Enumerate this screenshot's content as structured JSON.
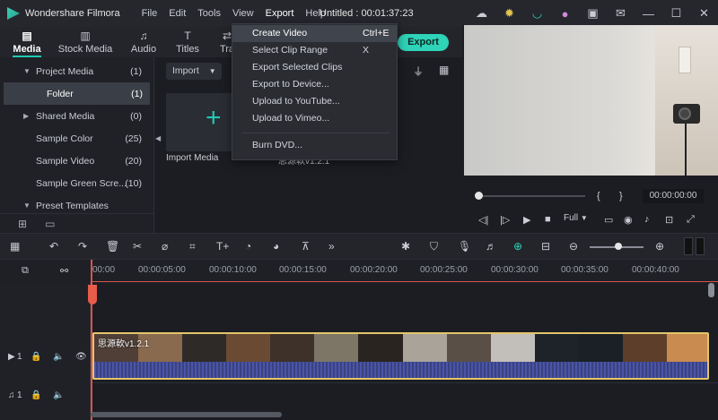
{
  "titlebar": {
    "app_name": "Wondershare Filmora",
    "menus": [
      "File",
      "Edit",
      "Tools",
      "View",
      "Export",
      "Help"
    ],
    "project_title": "Untitled : 00:01:37:23"
  },
  "tabs": [
    {
      "label": "Media",
      "icon": "media-icon"
    },
    {
      "label": "Stock Media",
      "icon": "stock-media-icon"
    },
    {
      "label": "Audio",
      "icon": "audio-icon"
    },
    {
      "label": "Titles",
      "icon": "titles-icon"
    },
    {
      "label": "Tra",
      "icon": "transitions-icon"
    }
  ],
  "export_button": "Export",
  "export_menu": [
    {
      "label": "Create Video",
      "shortcut": "Ctrl+E"
    },
    {
      "label": "Select Clip Range",
      "shortcut": "X"
    },
    {
      "label": "Export Selected Clips",
      "shortcut": ""
    },
    {
      "label": "Export to Device...",
      "shortcut": ""
    },
    {
      "label": "Upload to YouTube...",
      "shortcut": ""
    },
    {
      "label": "Upload to Vimeo...",
      "shortcut": ""
    },
    {
      "label": "Burn DVD...",
      "shortcut": ""
    }
  ],
  "sidebar": [
    {
      "label": "Project Media",
      "count": "(1)",
      "expanded": true
    },
    {
      "label": "Folder",
      "count": "(1)",
      "selected": true
    },
    {
      "label": "Shared Media",
      "count": "(0)",
      "expanded": false
    },
    {
      "label": "Sample Color",
      "count": "(25)"
    },
    {
      "label": "Sample Video",
      "count": "(20)"
    },
    {
      "label": "Sample Green Scre...",
      "count": "(10)"
    },
    {
      "label": "Preset Templates",
      "count": "",
      "expanded": true
    }
  ],
  "media": {
    "import_dropdown": "Import",
    "import_tile_label": "Import Media",
    "folder_label": "思源軟v1.2.1"
  },
  "preview": {
    "brace_open": "{",
    "brace_close": "}",
    "timecode": "00:00:00:00",
    "quality": "Full"
  },
  "ruler": [
    "00:00",
    "00:00:05:00",
    "00:00:10:00",
    "00:00:15:00",
    "00:00:20:00",
    "00:00:25:00",
    "00:00:30:00",
    "00:00:35:00",
    "00:00:40:00"
  ],
  "tracks": {
    "video_track_label": "1",
    "audio_track_label": "1",
    "clip_name": "思源軟v1.2.1"
  },
  "colors": {
    "accent": "#2fd3b8",
    "playhead": "#d9534f",
    "clip_border": "#e3c56a"
  }
}
